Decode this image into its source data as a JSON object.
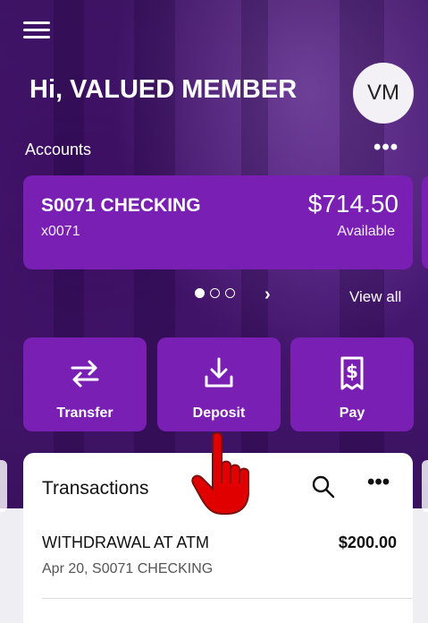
{
  "header": {
    "greeting": "Hi, VALUED MEMBER",
    "avatar_initials": "VM",
    "menu_icon": "hamburger-menu-icon"
  },
  "accounts": {
    "title": "Accounts",
    "more_icon": "more-horizontal-icon",
    "card": {
      "name": "S0071 CHECKING",
      "number": "x0071",
      "balance": "$714.50",
      "balance_label": "Available"
    },
    "pager": {
      "total_pages": 3,
      "current_page": 1
    },
    "view_all_label": "View all"
  },
  "actions": [
    {
      "label": "Transfer",
      "icon": "transfer-arrows-icon"
    },
    {
      "label": "Deposit",
      "icon": "deposit-download-icon"
    },
    {
      "label": "Pay",
      "icon": "bill-receipt-icon"
    }
  ],
  "transactions": {
    "title": "Transactions",
    "items": [
      {
        "description": "WITHDRAWAL AT ATM",
        "amount": "$200.00",
        "subtitle": "Apr 20, S0071 CHECKING"
      }
    ]
  },
  "colors": {
    "brand_purple": "#7a1fb3",
    "background_purple": "#4b1a78",
    "pointer_red": "#e00000"
  }
}
